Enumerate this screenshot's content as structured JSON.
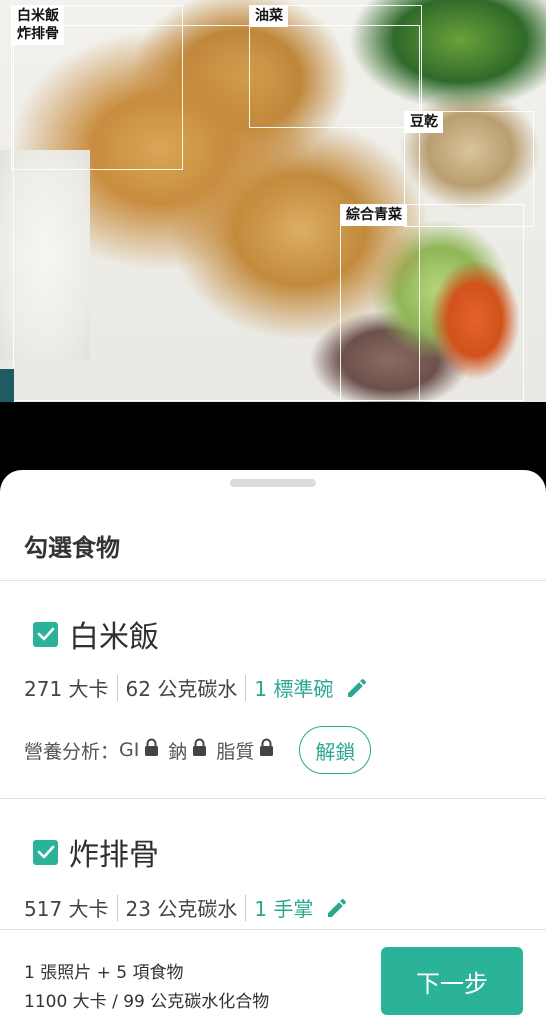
{
  "photo": {
    "boxes": [
      {
        "id": "rice-chop",
        "label": "白米飯\n炸排骨"
      },
      {
        "id": "you-cai",
        "label": "油菜"
      },
      {
        "id": "dou-gan",
        "label": "豆乾"
      },
      {
        "id": "mixed-veg",
        "label": "綜合青菜"
      }
    ]
  },
  "sheet": {
    "title": "勾選食物",
    "unlock_label": "解鎖",
    "foods": [
      {
        "name": "白米飯",
        "checked": true,
        "calories": "271 大卡",
        "carbs": "62 公克碳水",
        "portion": "1 標準碗",
        "nutrition_prefix": "營養分析：",
        "nutrients": [
          "GI",
          "鈉",
          "脂質"
        ]
      },
      {
        "name": "炸排骨",
        "checked": true,
        "calories": "517 大卡",
        "carbs": "23 公克碳水",
        "portion": "1 手掌"
      }
    ]
  },
  "footer": {
    "summary_line1": "1 張照片 + 5 項食物",
    "summary_line2": "1100 大卡 / 99 公克碳水化合物",
    "next_label": "下一步"
  },
  "colors": {
    "accent": "#2bb39a",
    "accent_text": "#2aa88f",
    "text_primary": "#333333",
    "divider": "#e3e3e3"
  }
}
